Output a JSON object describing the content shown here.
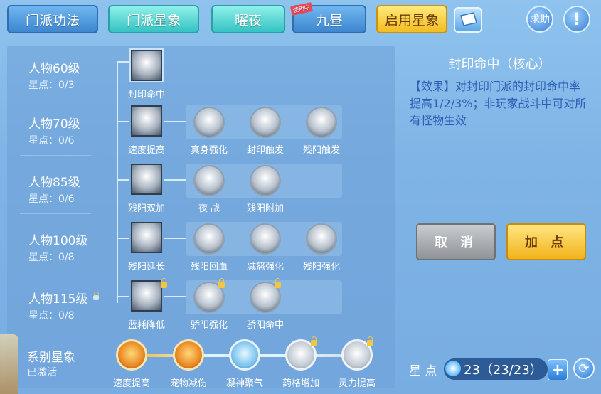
{
  "tabs": [
    {
      "label": "门派功法"
    },
    {
      "label": "门派星象"
    },
    {
      "label": "曜夜"
    },
    {
      "label": "九昼",
      "badge": "使用中"
    },
    {
      "label": "启用星象"
    }
  ],
  "header": {
    "help_label": "求助",
    "book_icon": "book-icon",
    "alert_icon": "exclamation-icon"
  },
  "rows": [
    {
      "level": "人物60级",
      "stars": "星点：0/3"
    },
    {
      "level": "人物70级",
      "stars": "星点：0/6"
    },
    {
      "level": "人物85级",
      "stars": "星点：0/6"
    },
    {
      "level": "人物100级",
      "stars": "星点：0/8",
      "locked": false
    },
    {
      "level": "人物115级",
      "stars": "星点：0/8",
      "locked": true
    }
  ],
  "skills": {
    "r1": {
      "main": "封印命中"
    },
    "r2": {
      "main": "速度提高",
      "subs": [
        "真身强化",
        "封印触发",
        "残阳触发"
      ]
    },
    "r3": {
      "main": "残阳双加",
      "subs": [
        "夜 战",
        "残阳附加"
      ]
    },
    "r4": {
      "main": "残阳延长",
      "subs": [
        "残阳回血",
        "减怒强化",
        "残阳强化"
      ]
    },
    "r5": {
      "main": "蓝耗降低",
      "subs": [
        "骄阳强化",
        "骄阳命中"
      ]
    }
  },
  "series": {
    "title": "系别星象",
    "status": "已激活",
    "skills": [
      "速度提高",
      "宠物减伤",
      "凝神聚气",
      "药格增加",
      "灵力提高"
    ]
  },
  "detail": {
    "title": "封印命中（核心）",
    "description": "【效果】对封印门派的封印命中率提高1/2/3%；非玩家战斗中可对所有怪物生效"
  },
  "buttons": {
    "cancel": "取 消",
    "add": "加 点"
  },
  "star_points": {
    "label": "星 点",
    "value": "23（23/23）",
    "plus": "+"
  }
}
